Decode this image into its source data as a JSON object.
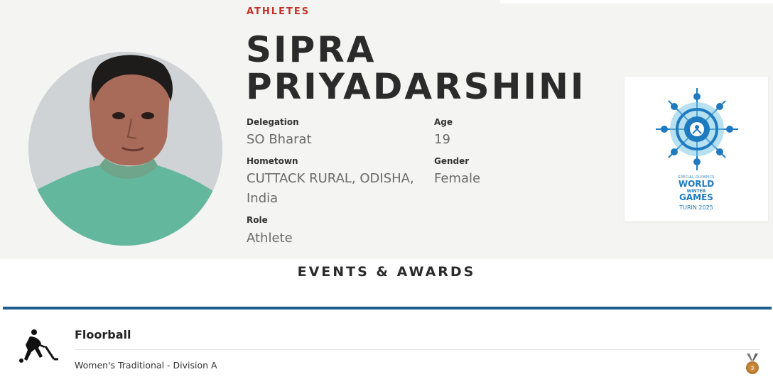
{
  "header": {
    "section": "ATHLETES"
  },
  "athlete": {
    "name_line1": "SIPRA",
    "name_line2": "PRIYADARSHINI",
    "fields": {
      "delegation_label": "Delegation",
      "delegation_value": "SO Bharat",
      "age_label": "Age",
      "age_value": "19",
      "hometown_label": "Hometown",
      "hometown_value_line1": "CUTTACK RURAL, ODISHA,",
      "hometown_value_line2": "India",
      "gender_label": "Gender",
      "gender_value": "Female",
      "role_label": "Role",
      "role_value": "Athlete"
    }
  },
  "logo": {
    "line1": "SPECIAL OLYMPICS",
    "line2": "WORLD",
    "line3": "WINTER",
    "line4": "GAMES",
    "line5": "TURIN 2025"
  },
  "events": {
    "title": "EVENTS & AWARDS",
    "items": [
      {
        "sport": "Floorball",
        "event": "Women's Traditional - Division A",
        "medal_rank": "3",
        "icon": "floorball-player-icon",
        "medal_icon": "bronze-medal-icon"
      }
    ]
  },
  "colors": {
    "accent_red": "#c8312a",
    "event_border": "#1d5e8c",
    "logo_blue": "#1f7bbf",
    "bronze": "#b9772c"
  }
}
